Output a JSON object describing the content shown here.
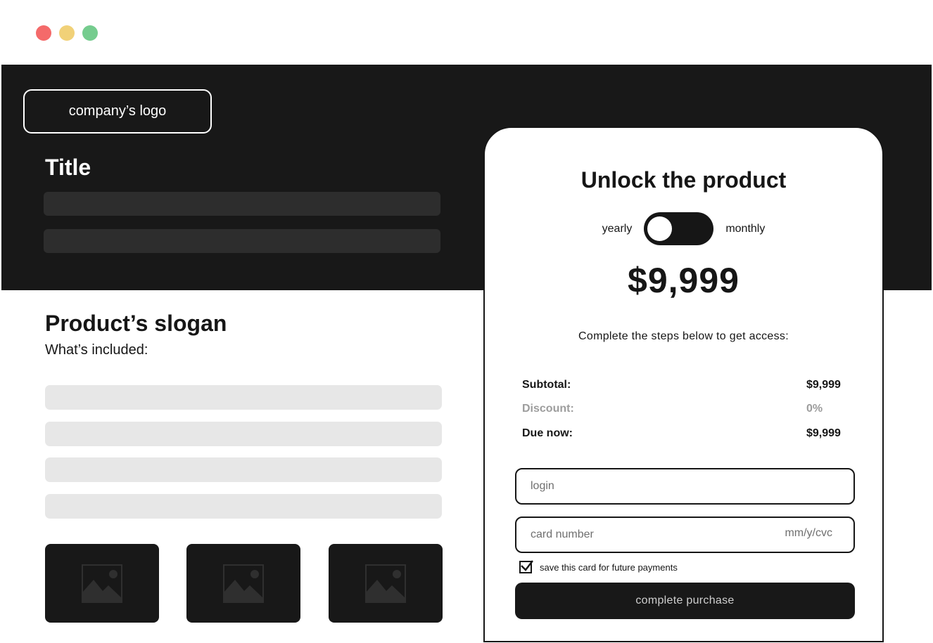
{
  "window": {
    "controls": [
      "close",
      "minimize",
      "maximize"
    ]
  },
  "hero": {
    "logo_label": "company’s logo",
    "title": "Title"
  },
  "content": {
    "slogan": "Product’s slogan",
    "included_label": "What’s included:",
    "image_placeholders": [
      "image-placeholder-icon",
      "image-placeholder-icon",
      "image-placeholder-icon"
    ]
  },
  "checkout": {
    "title": "Unlock the product",
    "billing": {
      "left_label": "yearly",
      "right_label": "monthly",
      "selected": "yearly"
    },
    "price": "$9,999",
    "instructions": "Complete the steps below to get access:",
    "summary": {
      "subtotal_label": "Subtotal:",
      "subtotal_value": "$9,999",
      "discount_label": "Discount:",
      "discount_value": "0%",
      "due_label": "Due now:",
      "due_value": "$9,999"
    },
    "login_placeholder": "login",
    "card_placeholder": "card number",
    "card_suffix": "mm/y/cvc",
    "save_card_label": "save this card for future payments",
    "save_card_checked": true,
    "submit_label": "complete purchase"
  },
  "colors": {
    "dark": "#181818",
    "hero_bar": "#2d2d2d",
    "light_bar": "#e7e7e7",
    "muted_text": "#9d9d9d",
    "dot_red": "#f46a6a",
    "dot_yellow": "#f1d178",
    "dot_green": "#75cc8e"
  }
}
